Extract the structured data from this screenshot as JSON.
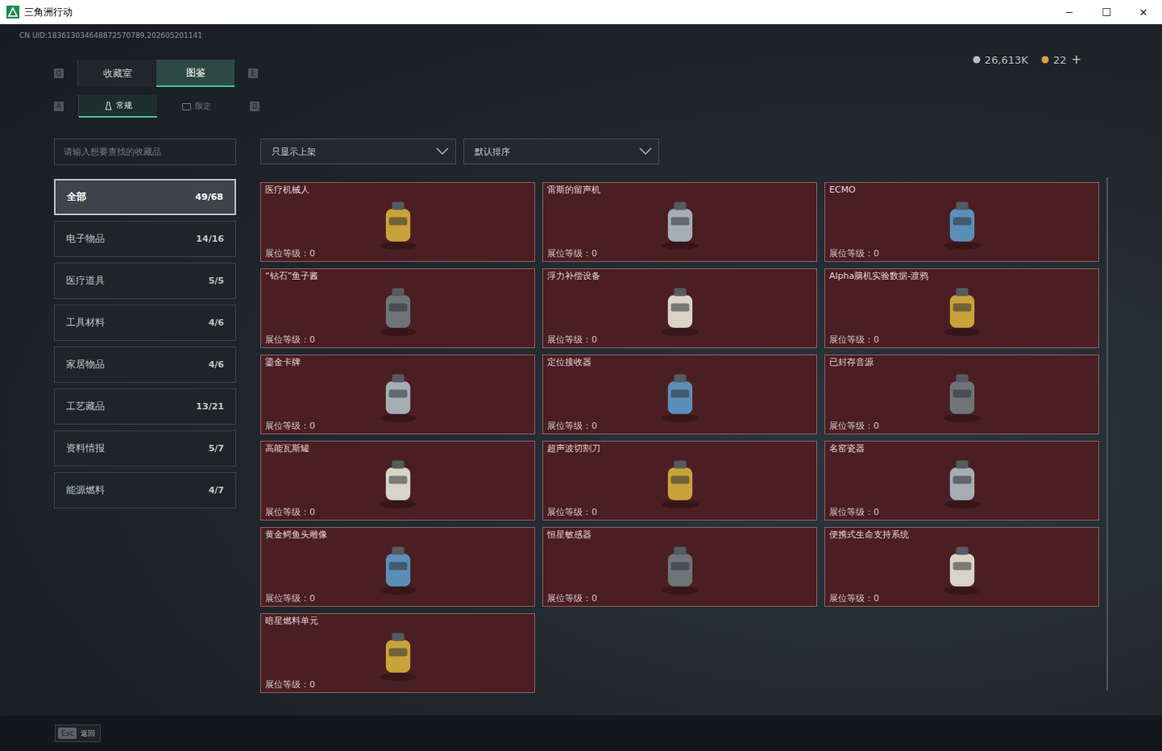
{
  "window": {
    "title": "三角洲行动",
    "controls": [
      "─",
      "☐",
      "✕"
    ]
  },
  "uid": "CN UID:183613034648872570789,202605201141",
  "currency": [
    {
      "value": "26,613K",
      "color": "#b9bec3"
    },
    {
      "value": "22",
      "color": "#d4a24a"
    }
  ],
  "currency_add": "+",
  "tabs": {
    "prev_key": "Q",
    "next_key": "E",
    "items": [
      {
        "label": "收藏室",
        "selected": false
      },
      {
        "label": "图鉴",
        "selected": true
      }
    ]
  },
  "subtabs": {
    "prev_key": "A",
    "next_key": "D",
    "items": [
      {
        "label": "常规",
        "selected": true
      },
      {
        "label": "限定",
        "selected": false
      }
    ]
  },
  "search": {
    "placeholder": "请输入想要查找的收藏品"
  },
  "filters": [
    {
      "label": "只显示上架"
    },
    {
      "label": "默认排序"
    }
  ],
  "categories": [
    {
      "label": "全部",
      "count": "49/68",
      "selected": true
    },
    {
      "label": "电子物品",
      "count": "14/16",
      "selected": false
    },
    {
      "label": "医疗道具",
      "count": "5/5",
      "selected": false
    },
    {
      "label": "工具材料",
      "count": "4/6",
      "selected": false
    },
    {
      "label": "家居物品",
      "count": "4/6",
      "selected": false
    },
    {
      "label": "工艺藏品",
      "count": "13/21",
      "selected": false
    },
    {
      "label": "资料情报",
      "count": "5/7",
      "selected": false
    },
    {
      "label": "能源燃料",
      "count": "4/7",
      "selected": false
    }
  ],
  "items": [
    {
      "name": "医疗机械人",
      "level_label": "展位等级：",
      "level": "0"
    },
    {
      "name": "雷斯的留声机",
      "level_label": "展位等级：",
      "level": "0"
    },
    {
      "name": "ECMO",
      "level_label": "展位等级：",
      "level": "0"
    },
    {
      "name": "“钻石”鱼子酱",
      "level_label": "展位等级：",
      "level": "0"
    },
    {
      "name": "浮力补偿设备",
      "level_label": "展位等级：",
      "level": "0"
    },
    {
      "name": "Alpha脑机实验数据-渡鸦",
      "level_label": "展位等级：",
      "level": "0"
    },
    {
      "name": "鎏金卡牌",
      "level_label": "展位等级：",
      "level": "0"
    },
    {
      "name": "定位接收器",
      "level_label": "展位等级：",
      "level": "0"
    },
    {
      "name": "已封存音源",
      "level_label": "展位等级：",
      "level": "0"
    },
    {
      "name": "高能瓦斯罐",
      "level_label": "展位等级：",
      "level": "0"
    },
    {
      "name": "超声波切割刀",
      "level_label": "展位等级：",
      "level": "0"
    },
    {
      "name": "名窑瓷器",
      "level_label": "展位等级：",
      "level": "0"
    },
    {
      "name": "黄金鳄鱼头雕像",
      "level_label": "展位等级：",
      "level": "0"
    },
    {
      "name": "恒星敏感器",
      "level_label": "展位等级：",
      "level": "0"
    },
    {
      "name": "便携式生命支持系统",
      "level_label": "展位等级：",
      "level": "0"
    },
    {
      "name": "暗星燃料单元",
      "level_label": "展位等级：",
      "level": "0"
    }
  ],
  "footer": {
    "key": "Esc",
    "label": "返回"
  }
}
